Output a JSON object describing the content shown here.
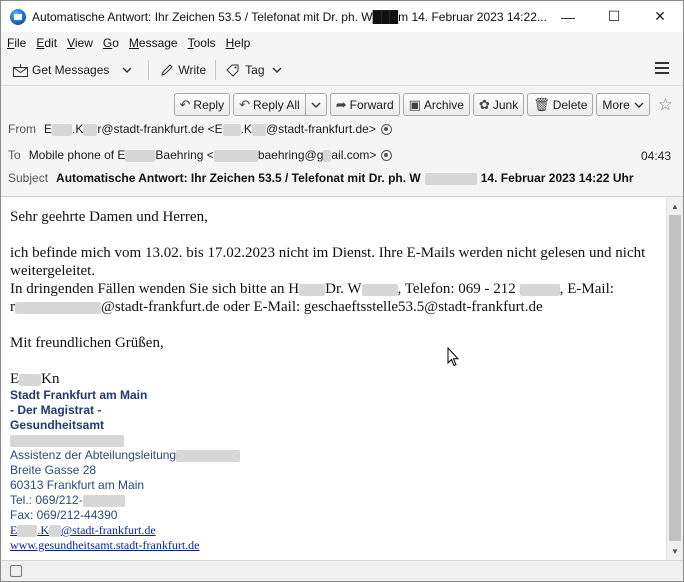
{
  "window": {
    "title": "Automatische Antwort: Ihr Zeichen 53.5 / Telefonat mit Dr. ph. W███m 14. Februar 2023 14:22...",
    "minimize": "—",
    "maximize": "☐",
    "close": "✕"
  },
  "menu": [
    {
      "label": "File",
      "key": "F",
      "rest": "ile"
    },
    {
      "label": "Edit",
      "key": "E",
      "rest": "dit"
    },
    {
      "label": "View",
      "key": "V",
      "rest": "iew"
    },
    {
      "label": "Go",
      "key": "G",
      "rest": "o"
    },
    {
      "label": "Message",
      "key": "M",
      "rest": "essage"
    },
    {
      "label": "Tools",
      "key": "T",
      "rest": "ools"
    },
    {
      "label": "Help",
      "key": "H",
      "rest": "elp"
    }
  ],
  "toolbar": {
    "get_messages": "Get Messages",
    "write": "Write",
    "tag": "Tag"
  },
  "actions": {
    "reply": "Reply",
    "reply_all": "Reply All",
    "forward": "Forward",
    "archive": "Archive",
    "junk": "Junk",
    "delete": "Delete",
    "more": "More"
  },
  "header": {
    "from_label": "From",
    "from_name_a": "E",
    "from_name_b": ".K",
    "from_name_c": "r@stadt-frankfurt.de <E",
    "from_name_d": ".K",
    "from_name_e": "@stadt-frankfurt.de>",
    "to_label": "To",
    "to_a": "Mobile phone of E",
    "to_b": "Baehring <",
    "to_c": "baehring@g",
    "to_d": "ail.com>",
    "time": "04:43",
    "subject_label": "Subject",
    "subject_a": "Automatische Antwort: Ihr Zeichen 53.5 / Telefonat mit Dr. ph. W",
    "subject_b": "14. Februar 2023 14:22 Uhr"
  },
  "message": {
    "greeting": "Sehr geehrte Damen und Herren,",
    "line1": "ich befinde mich vom 13.02. bis 17.02.2023  nicht im Dienst. Ihre E-Mails werden nicht gelesen und nicht weitergeleitet.",
    "line2a": "In dringenden Fällen wenden Sie sich bitte an H",
    "line2b": "Dr. W",
    "line2c": ", Telefon: 069 - 212",
    "line2d": ", E-Mail:",
    "line3a": "r",
    "line3b": "@stadt-frankfurt.de oder E-Mail: geschaeftsstelle53.5@stadt-frankfurt.de",
    "closing": "Mit freundlichen Grüßen,",
    "signer_a": "E",
    "signer_b": "Kn",
    "sig_org1": "Stadt Frankfurt am Main",
    "sig_org2": "- Der Magistrat -",
    "sig_org3": "Gesundheitsamt",
    "sig_role": "Assistenz der Abteilungsleitung",
    "sig_street": "Breite Gasse 28",
    "sig_city": "60313 Frankfurt am Main",
    "sig_tel": "Tel.: 069/212-",
    "sig_fax": "Fax: 069/212-44390",
    "sig_mail_a": "E",
    "sig_mail_b": ".K",
    "sig_mail_c": "@stadt-frankfurt.de",
    "sig_web": "www.gesundheitsamt.stadt-frankfurt.de"
  }
}
